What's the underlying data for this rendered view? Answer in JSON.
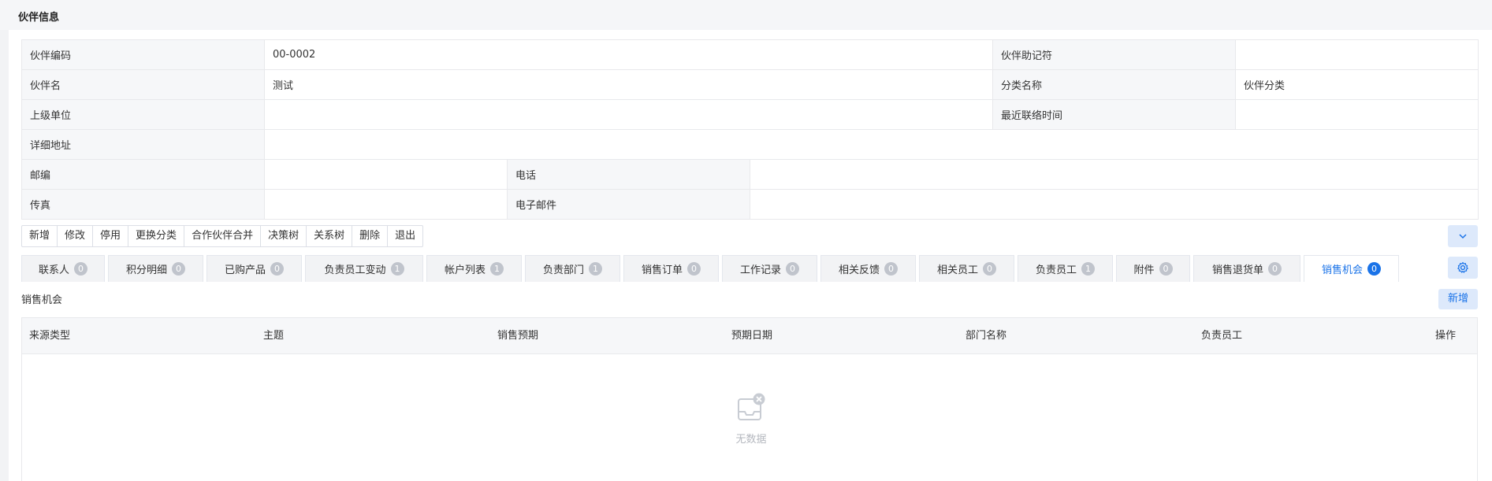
{
  "page": {
    "title": "伙伴信息"
  },
  "info": {
    "code_label": "伙伴编码",
    "code_value": "00-0002",
    "mnemonic_label": "伙伴助记符",
    "mnemonic_value": "",
    "name_label": "伙伴名",
    "name_value": "测试",
    "category_label": "分类名称",
    "category_value": "伙伴分类",
    "parent_label": "上级单位",
    "parent_value": "",
    "last_contact_label": "最近联络时间",
    "last_contact_value": "",
    "address_label": "详细地址",
    "address_value": "",
    "postcode_label": "邮编",
    "postcode_value": "",
    "phone_label": "电话",
    "phone_value": "",
    "fax_label": "传真",
    "fax_value": "",
    "email_label": "电子邮件",
    "email_value": ""
  },
  "toolbar": {
    "add": "新增",
    "edit": "修改",
    "disable": "停用",
    "change_category": "更换分类",
    "merge": "合作伙伴合并",
    "decision_tree": "决策树",
    "relation_tree": "关系树",
    "delete": "删除",
    "exit": "退出"
  },
  "tabs": [
    {
      "label": "联系人",
      "count": "0"
    },
    {
      "label": "积分明细",
      "count": "0"
    },
    {
      "label": "已购产品",
      "count": "0"
    },
    {
      "label": "负责员工变动",
      "count": "1"
    },
    {
      "label": "帐户列表",
      "count": "1"
    },
    {
      "label": "负责部门",
      "count": "1"
    },
    {
      "label": "销售订单",
      "count": "0"
    },
    {
      "label": "工作记录",
      "count": "0"
    },
    {
      "label": "相关反馈",
      "count": "0"
    },
    {
      "label": "相关员工",
      "count": "0"
    },
    {
      "label": "负责员工",
      "count": "1"
    },
    {
      "label": "附件",
      "count": "0"
    },
    {
      "label": "销售退货单",
      "count": "0"
    },
    {
      "label": "销售机会",
      "count": "0"
    }
  ],
  "section": {
    "title": "销售机会",
    "new_button": "新增"
  },
  "grid": {
    "columns": [
      "来源类型",
      "主题",
      "销售预期",
      "预期日期",
      "部门名称",
      "负责员工",
      "操作"
    ],
    "empty_text": "无数据"
  },
  "colors": {
    "accent": "#1a73e8",
    "accent_light": "#dde9fb",
    "badge_gray": "#c0c4cc"
  },
  "icons": {
    "collapse": "chevron-down-icon",
    "settings": "gear-icon",
    "empty": "empty-inbox-icon"
  }
}
